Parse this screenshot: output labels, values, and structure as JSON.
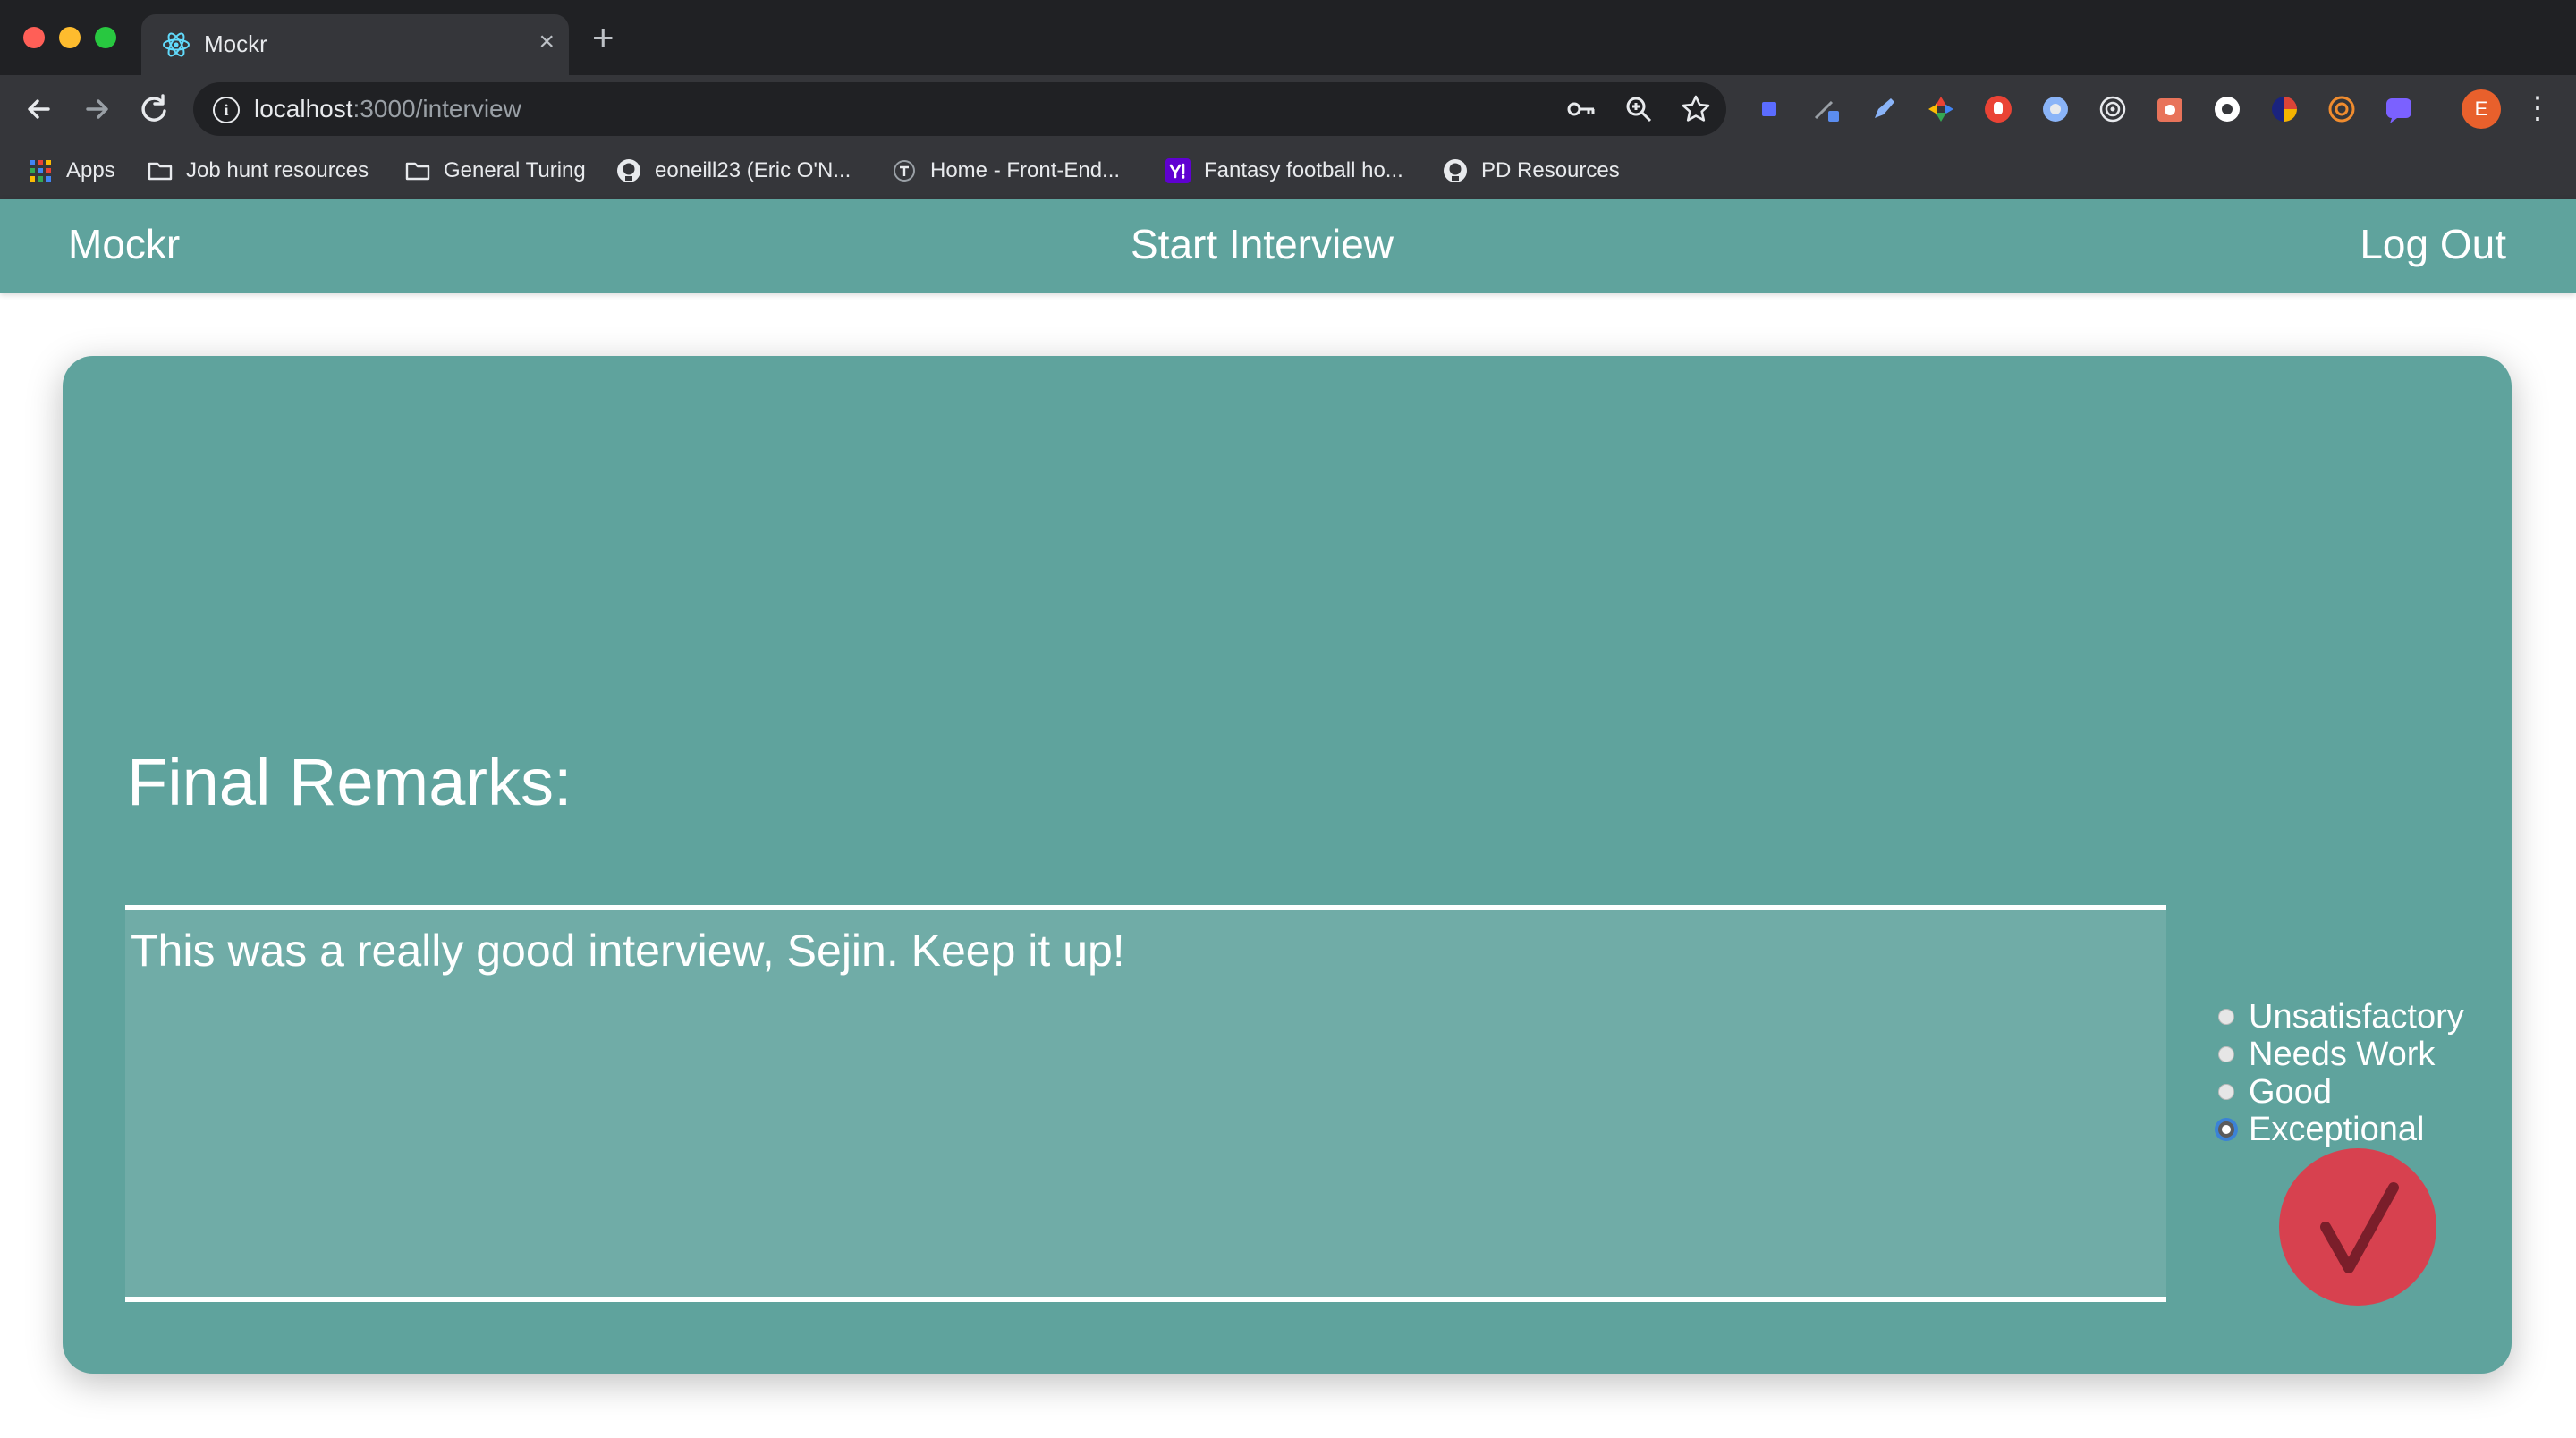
{
  "browser": {
    "tab_title": "Mockr",
    "tab_close": "×",
    "new_tab": "+",
    "url_host": "localhost",
    "url_path": ":3000/interview",
    "profile_initial": "E",
    "menu": "⋮",
    "extension_colors": [
      "#5b6cff",
      "#9aa0a6",
      "#8ab4f8",
      "#f4b400",
      "#ea4335",
      "#8ab4f8",
      "#e8eaed",
      "#e8735a",
      "#ffffff",
      "#db4437",
      "#f08c2e",
      "#7b61ff"
    ],
    "bookmarks": [
      {
        "label": "Apps",
        "icon": "apps-grid-icon"
      },
      {
        "label": "Job hunt resources",
        "icon": "folder-icon"
      },
      {
        "label": "General Turing",
        "icon": "folder-icon"
      },
      {
        "label": "eoneill23 (Eric O'N...",
        "icon": "github-icon"
      },
      {
        "label": "Home - Front-End...",
        "icon": "turing-icon"
      },
      {
        "label": "Fantasy football ho...",
        "icon": "yahoo-icon"
      },
      {
        "label": "PD Resources",
        "icon": "github-icon"
      }
    ]
  },
  "nav": {
    "brand": "Mockr",
    "start_interview": "Start Interview",
    "log_out": "Log Out"
  },
  "remarks": {
    "title": "Final Remarks:",
    "text": "This was a really good interview, Sejin. Keep it up!"
  },
  "rating": {
    "options": [
      "Unsatisfactory",
      "Needs Work",
      "Good",
      "Exceptional"
    ],
    "selected": "Exceptional"
  },
  "colors": {
    "app_teal": "#5fa39d",
    "textarea_bg": "#70aca7",
    "submit_red": "#d7414f"
  }
}
